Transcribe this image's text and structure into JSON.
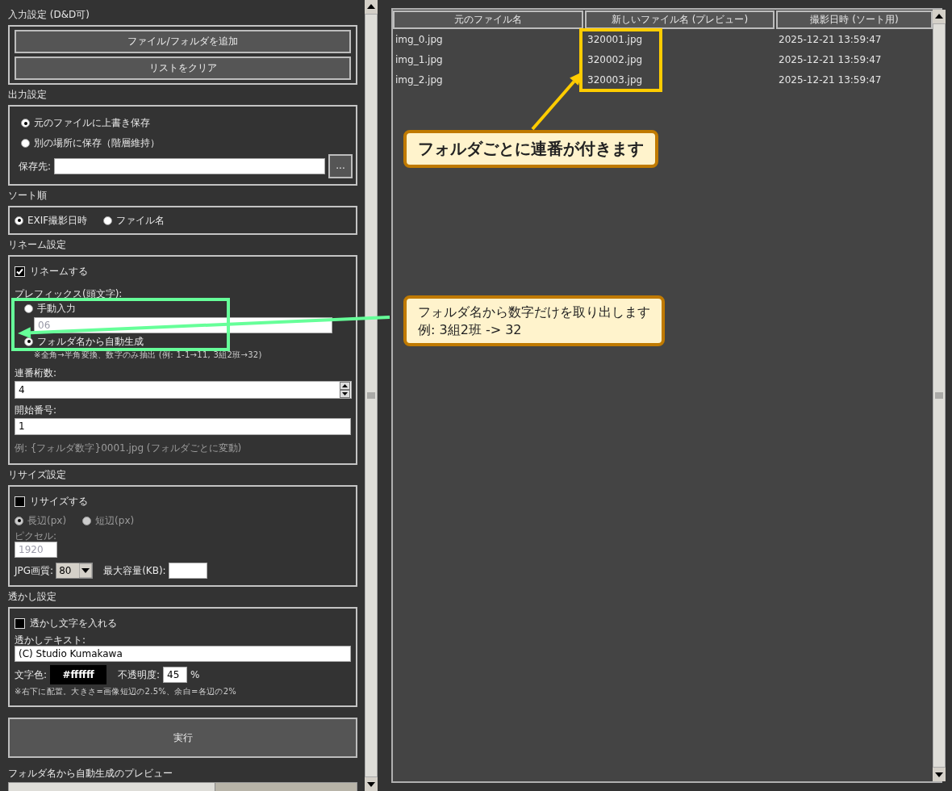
{
  "input_section": {
    "title": "入力設定 (D&D可)",
    "buttons": [
      "ファイル/フォルダを追加",
      "リストをクリア"
    ]
  },
  "output_section": {
    "title": "出力設定",
    "options": [
      {
        "label": "元のファイルに上書き保存",
        "selected": true
      },
      {
        "label": "別の場所に保存（階層維持）",
        "selected": false
      }
    ],
    "dest_label": "保存先:",
    "browse_button": "..."
  },
  "sort_section": {
    "title": "ソート順",
    "options": [
      {
        "label": "EXIF撮影日時",
        "selected": true
      },
      {
        "label": "ファイル名",
        "selected": false
      }
    ]
  },
  "rename_section": {
    "title": "リネーム設定",
    "rename_checkbox": {
      "label": "リネームする",
      "checked": true
    },
    "prefix_label": "プレフィックス(頭文字):",
    "prefix_options": [
      {
        "label": "手動入力",
        "selected": false
      },
      {
        "label": "フォルダ名から自動生成",
        "selected": true
      }
    ],
    "manual_value": "06",
    "manual_disabled": true,
    "prefix_note": "※全角→半角変換、数字のみ抽出 (例: 1-1→11, 3組2班→32)",
    "digits_label": "連番桁数:",
    "digits_value": "4",
    "start_label": "開始番号:",
    "start_value": "1",
    "example": "例: {フォルダ数字}0001.jpg (フォルダごとに変動)"
  },
  "resize_section": {
    "title": "リサイズ設定",
    "resize_checkbox": {
      "label": "リサイズする",
      "checked": false
    },
    "disabled": true,
    "options": [
      {
        "label": "長辺(px)",
        "selected": true
      },
      {
        "label": "短辺(px)",
        "selected": false
      }
    ],
    "pixel_label": "ピクセル:",
    "pixel_value": "1920",
    "quality_label": "JPG画質:",
    "quality_value": "80",
    "max_size_label": "最大容量(KB):"
  },
  "watermark_section": {
    "title": "透かし設定",
    "watermark_checkbox": {
      "label": "透かし文字を入れる",
      "checked": false
    },
    "text_label": "透かしテキスト:",
    "text_value": "(C) Studio Kumakawa",
    "color_label": "文字色:",
    "color_value": "#ffffff",
    "opacity_label": "不透明度:",
    "opacity_value": "45",
    "percent": "%",
    "note": "※右下に配置。大きさ=画像短辺の2.5%、余白=各辺の2%"
  },
  "run_button": "実行",
  "preview_label": "フォルダ名から自動生成のプレビュー",
  "table": {
    "columns": [
      "元のファイル名",
      "新しいファイル名 (プレビュー)",
      "撮影日時 (ソート用)"
    ],
    "rows": [
      [
        "img_0.jpg",
        "320001.jpg",
        "2025-12-21 13:59:47"
      ],
      [
        "img_1.jpg",
        "320002.jpg",
        "2025-12-21 13:59:47"
      ],
      [
        "img_2.jpg",
        "320003.jpg",
        "2025-12-21 13:59:47"
      ]
    ]
  },
  "annotations": [
    {
      "kind": "callout",
      "lines": [
        "フォルダごとに連番が付きます"
      ],
      "color": "#ffcc00",
      "emphasis": true
    },
    {
      "kind": "callout",
      "lines": [
        "フォルダ名から数字だけを取り出します",
        "例: 3組2班 -> 32"
      ],
      "color": "#66ff99",
      "emphasis": false
    }
  ]
}
